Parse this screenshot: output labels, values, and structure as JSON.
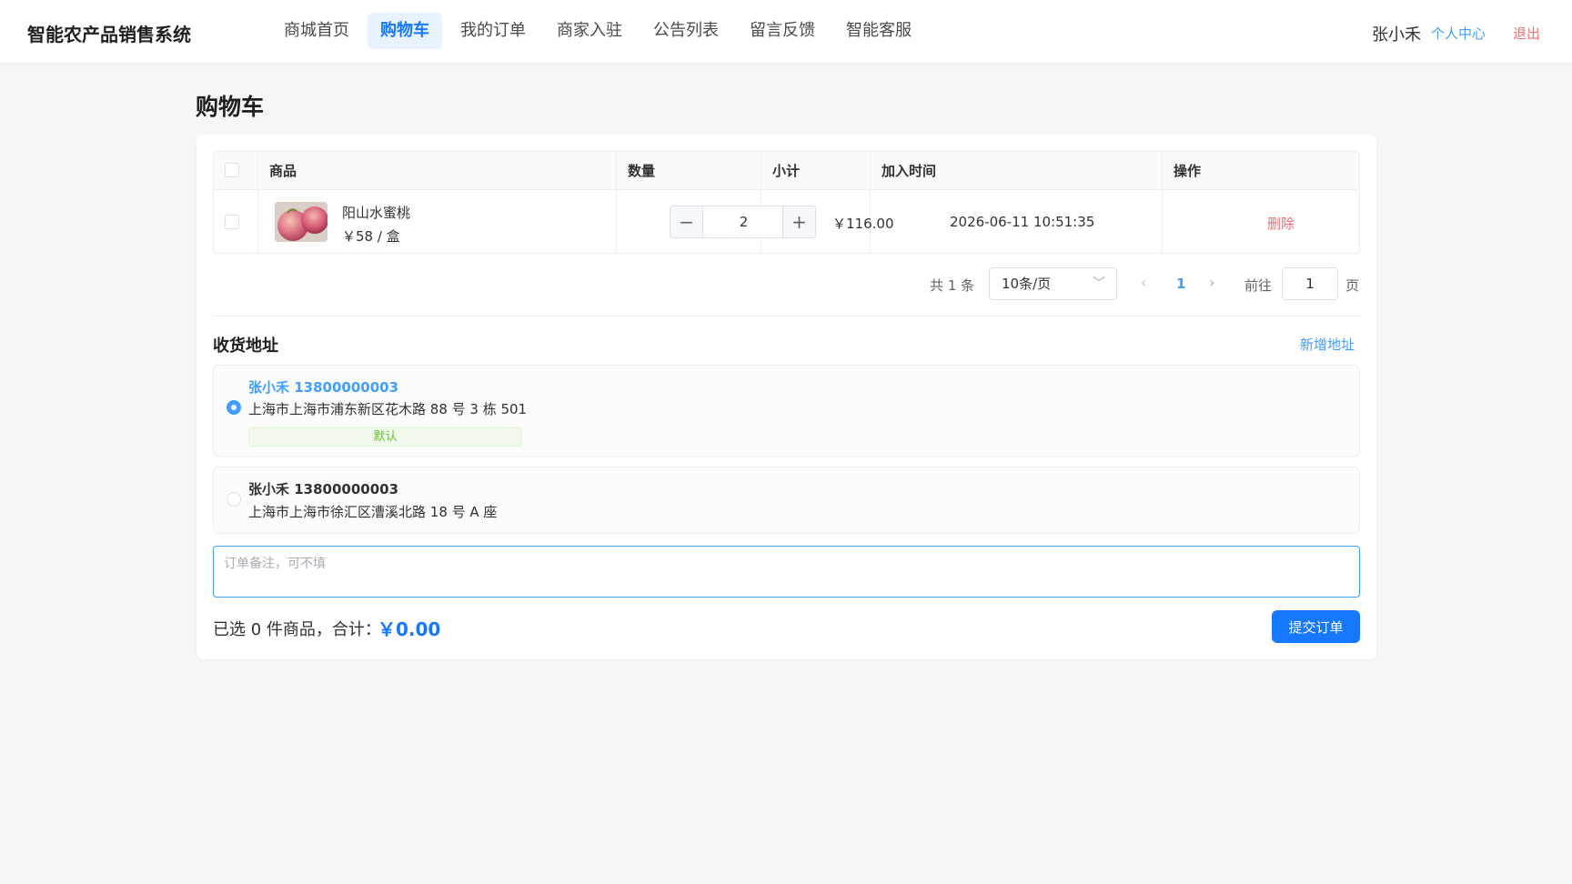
{
  "header": {
    "brand": "智能农产品销售系统",
    "nav": [
      {
        "label": "商城首页",
        "active": false
      },
      {
        "label": "购物车",
        "active": true
      },
      {
        "label": "我的订单",
        "active": false
      },
      {
        "label": "商家入驻",
        "active": false
      },
      {
        "label": "公告列表",
        "active": false
      },
      {
        "label": "留言反馈",
        "active": false
      },
      {
        "label": "智能客服",
        "active": false
      }
    ],
    "user_name": "张小禾",
    "user_center": "个人中心",
    "logout": "退出"
  },
  "page": {
    "title": "购物车"
  },
  "cart": {
    "columns": {
      "product": "商品",
      "quantity": "数量",
      "subtotal": "小计",
      "added_at": "加入时间",
      "actions": "操作"
    },
    "items": [
      {
        "name": "阳山水蜜桃",
        "price": "￥58 / 盒",
        "quantity": "2",
        "subtotal": "￥116.00",
        "added_at": "2026-06-11 10:51:35",
        "delete_label": "删除",
        "checked": false,
        "image_icon": "peach-photo"
      }
    ],
    "pagination": {
      "total": "共 1 条",
      "page_size": "10条/页",
      "current_page": "1",
      "goto_label": "前往",
      "goto_value": "1",
      "page_suffix": "页"
    }
  },
  "address": {
    "title": "收货地址",
    "add_label": "新增地址",
    "items": [
      {
        "contact": "张小禾 13800000003",
        "detail": "上海市上海市浦东新区花木路 88 号 3 栋 501",
        "tag": "默认",
        "selected": true
      },
      {
        "contact": "张小禾 13800000003",
        "detail": "上海市上海市徐汇区漕溪北路 18 号 A 座",
        "selected": false
      }
    ]
  },
  "remark": {
    "placeholder": "订单备注，可不填",
    "value": ""
  },
  "footer": {
    "summary": "已选 0 件商品，合计：",
    "total": "￥0.00",
    "submit_label": "提交订单"
  },
  "colors": {
    "accent": "#1677ff",
    "link": "#409eff",
    "danger": "#f56c6c",
    "success": "#67c23a",
    "background": "#f5f6f8"
  }
}
